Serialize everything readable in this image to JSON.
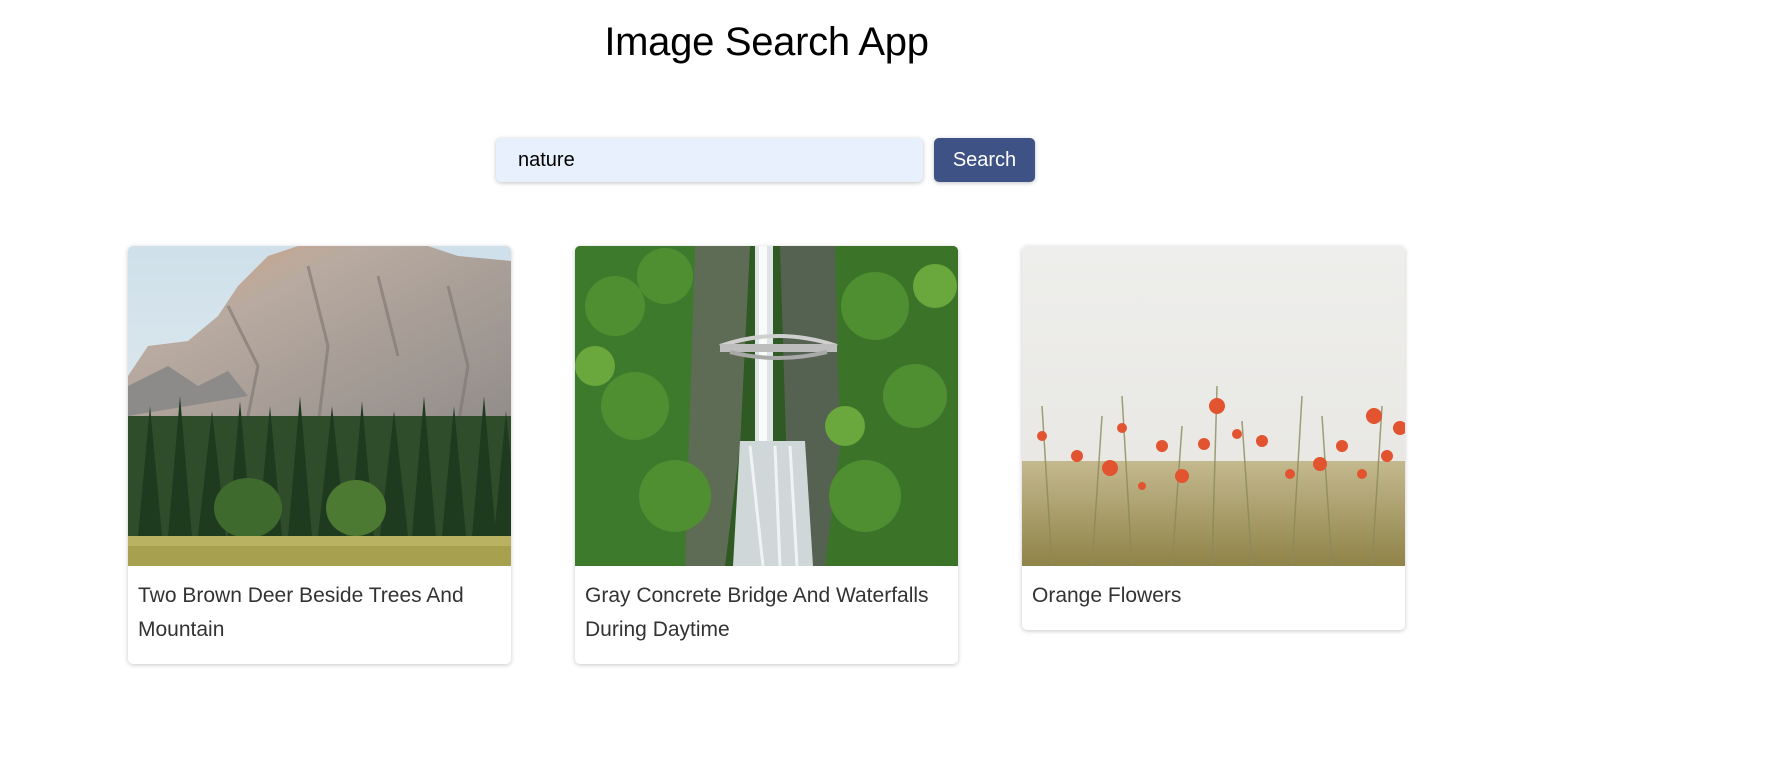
{
  "app": {
    "title": "Image Search App"
  },
  "search": {
    "value": "nature",
    "button_label": "Search"
  },
  "results": [
    {
      "caption": "Two Brown Deer Beside Trees And Mountain",
      "image": "mountain-forest-photo"
    },
    {
      "caption": "Gray Concrete Bridge And Waterfalls During Daytime",
      "image": "waterfall-bridge-photo"
    },
    {
      "caption": "Orange Flowers",
      "image": "orange-flowers-photo"
    }
  ],
  "colors": {
    "search_input_bg": "#e8f0fe",
    "search_button_bg": "#3e5286"
  }
}
